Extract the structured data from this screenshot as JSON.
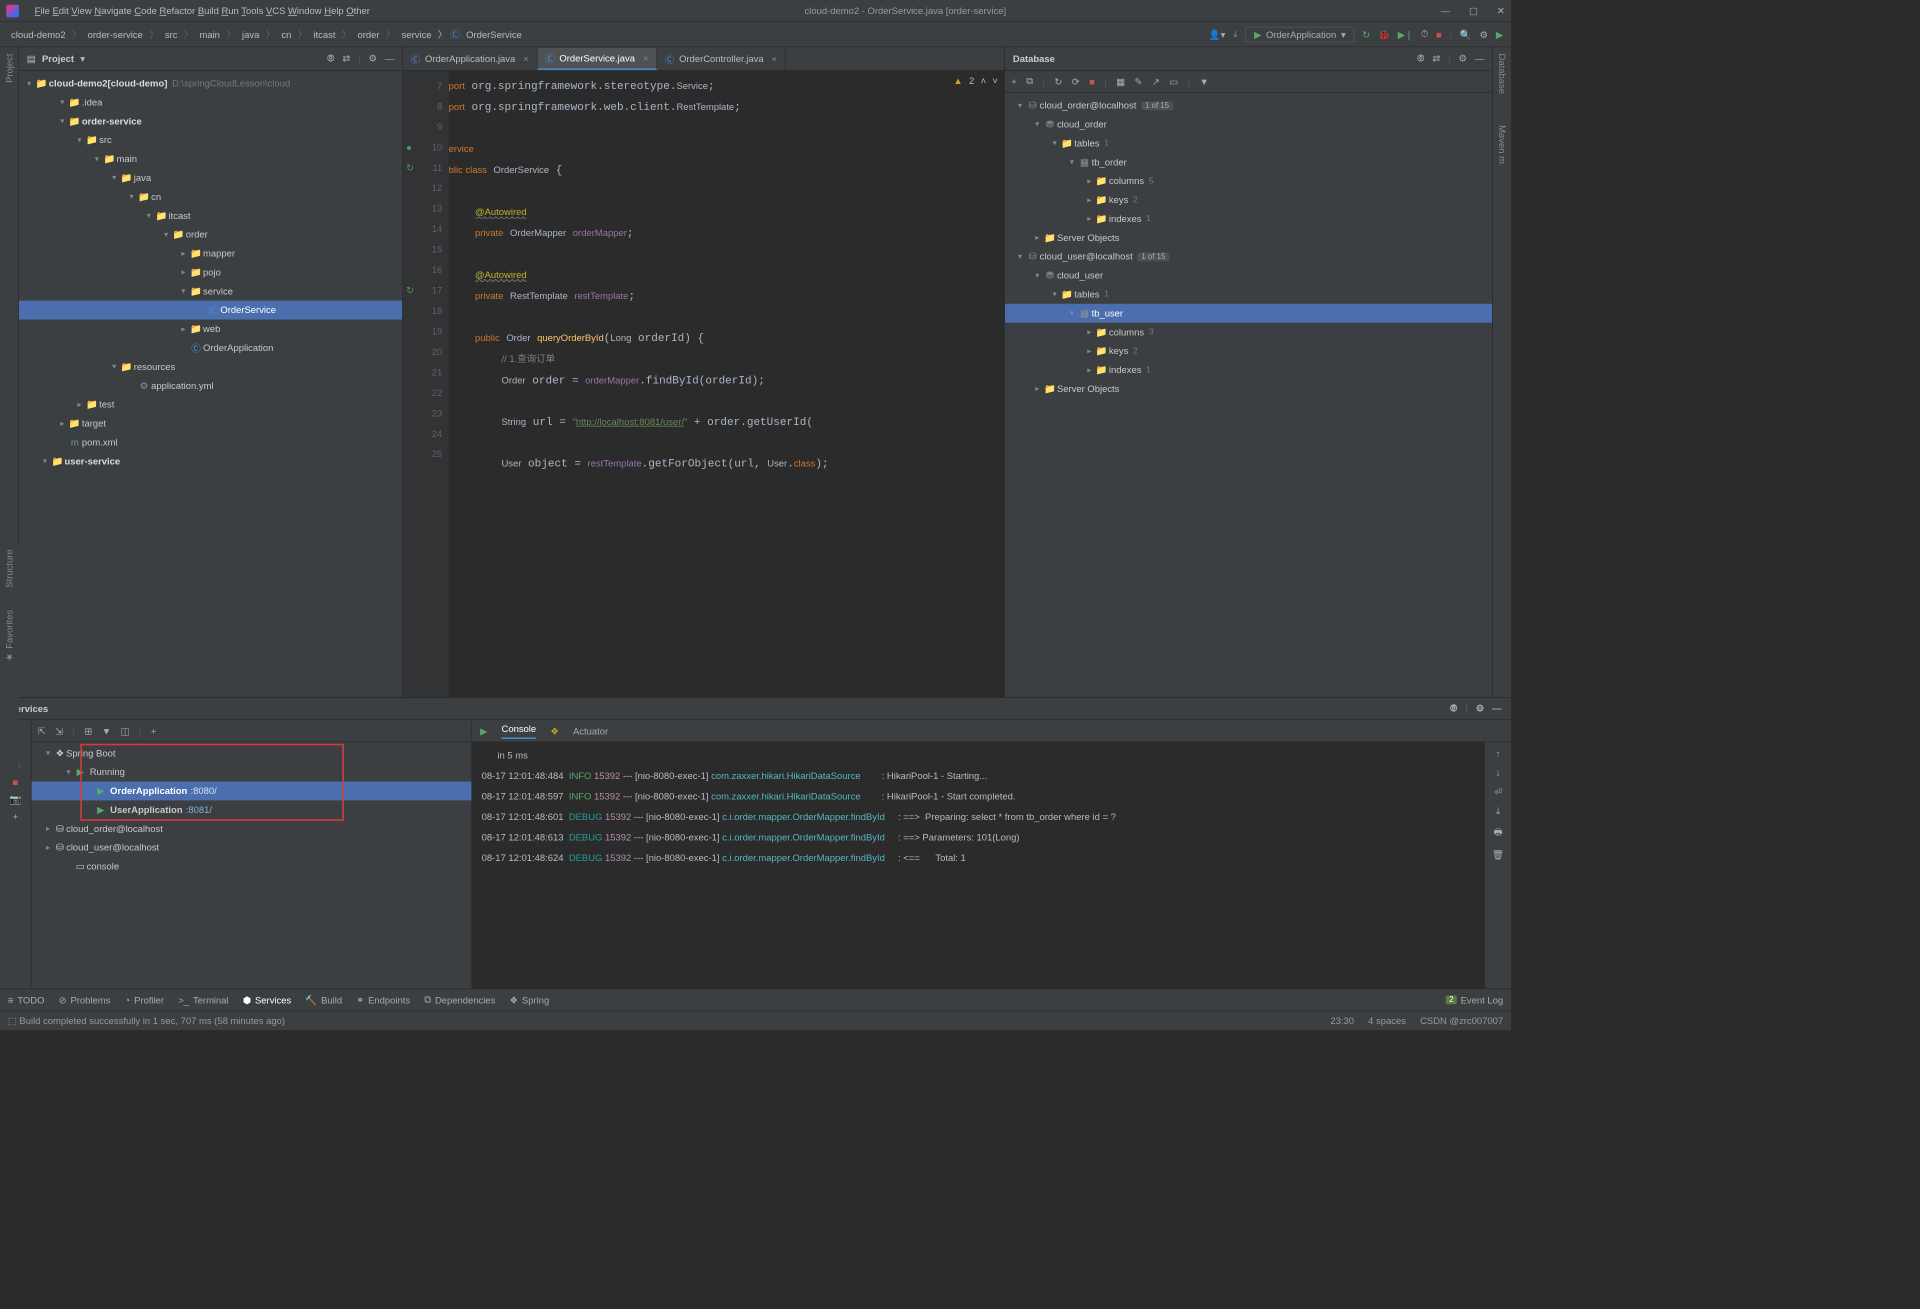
{
  "window_title": "cloud-demo2 - OrderService.java [order-service]",
  "menu": [
    "File",
    "Edit",
    "View",
    "Navigate",
    "Code",
    "Refactor",
    "Build",
    "Run",
    "Tools",
    "VCS",
    "Window",
    "Help",
    "Other"
  ],
  "breadcrumbs": [
    "cloud-demo2",
    "order-service",
    "src",
    "main",
    "java",
    "cn",
    "itcast",
    "order",
    "service",
    "OrderService"
  ],
  "run_config": "OrderApplication",
  "project": {
    "title": "Project",
    "root": {
      "name": "cloud-demo2",
      "bold": "[cloud-demo]",
      "path": "D:\\springCloudLesson\\cloud"
    },
    "nodes": [
      {
        "d": 1,
        "tw": "▾",
        "icon": "📁",
        "cls": "dir",
        "txt": ".idea"
      },
      {
        "d": 1,
        "tw": "▾",
        "icon": "📁",
        "cls": "pkg",
        "txt": "order-service",
        "bold": true
      },
      {
        "d": 2,
        "tw": "▾",
        "icon": "📁",
        "cls": "pkg",
        "txt": "src"
      },
      {
        "d": 3,
        "tw": "▾",
        "icon": "📁",
        "cls": "pkg",
        "txt": "main"
      },
      {
        "d": 4,
        "tw": "▾",
        "icon": "📁",
        "cls": "pkg",
        "txt": "java"
      },
      {
        "d": 5,
        "tw": "▾",
        "icon": "📁",
        "cls": "pkg",
        "txt": "cn"
      },
      {
        "d": 6,
        "tw": "▾",
        "icon": "📁",
        "cls": "pkg",
        "txt": "itcast"
      },
      {
        "d": 7,
        "tw": "▾",
        "icon": "📁",
        "cls": "pkg",
        "txt": "order"
      },
      {
        "d": 8,
        "tw": "▸",
        "icon": "📁",
        "cls": "pkg",
        "txt": "mapper"
      },
      {
        "d": 8,
        "tw": "▸",
        "icon": "📁",
        "cls": "pkg",
        "txt": "pojo"
      },
      {
        "d": 8,
        "tw": "▾",
        "icon": "📁",
        "cls": "pkg",
        "txt": "service"
      },
      {
        "d": 9,
        "tw": "",
        "icon": "Ⓒ",
        "cls": "file",
        "txt": "OrderService",
        "sel": true
      },
      {
        "d": 8,
        "tw": "▸",
        "icon": "📁",
        "cls": "pkg",
        "txt": "web"
      },
      {
        "d": 8,
        "tw": "",
        "icon": "Ⓒ",
        "cls": "file",
        "txt": "OrderApplication"
      },
      {
        "d": 4,
        "tw": "▾",
        "icon": "📁",
        "cls": "pkg",
        "txt": "resources"
      },
      {
        "d": 5,
        "tw": "",
        "icon": "⚙",
        "cls": "file",
        "txt": "application.yml"
      },
      {
        "d": 2,
        "tw": "▸",
        "icon": "📁",
        "cls": "dir",
        "txt": "test"
      },
      {
        "d": 1,
        "tw": "▸",
        "icon": "📁",
        "cls": "dir",
        "txt": "target",
        "orange": true
      },
      {
        "d": 1,
        "tw": "",
        "icon": "m",
        "cls": "file",
        "txt": "pom.xml"
      },
      {
        "d": 0,
        "tw": "▾",
        "icon": "📁",
        "cls": "pkg",
        "txt": "user-service",
        "bold": true
      }
    ]
  },
  "tabs": [
    {
      "name": "OrderApplication.java",
      "act": false
    },
    {
      "name": "OrderService.java",
      "act": true
    },
    {
      "name": "OrderController.java",
      "act": false
    }
  ],
  "editor": {
    "warn": "2",
    "lines": [
      7,
      8,
      9,
      10,
      11,
      12,
      13,
      14,
      15,
      16,
      17,
      18,
      19,
      20,
      21,
      22,
      23,
      24,
      25
    ],
    "gicons": {
      "10": "●",
      "11": "↻",
      "17": "↻"
    }
  },
  "database": {
    "title": "Database",
    "nodes": [
      {
        "d": 0,
        "tw": "▾",
        "icon": "⛁",
        "txt": "cloud_order@localhost",
        "pill": "1 of 15"
      },
      {
        "d": 1,
        "tw": "▾",
        "icon": "⛃",
        "txt": "cloud_order"
      },
      {
        "d": 2,
        "tw": "▾",
        "icon": "📁",
        "txt": "tables",
        "cnt": "1"
      },
      {
        "d": 3,
        "tw": "▾",
        "icon": "▦",
        "txt": "tb_order"
      },
      {
        "d": 4,
        "tw": "▸",
        "icon": "📁",
        "txt": "columns",
        "cnt": "5"
      },
      {
        "d": 4,
        "tw": "▸",
        "icon": "📁",
        "txt": "keys",
        "cnt": "2"
      },
      {
        "d": 4,
        "tw": "▸",
        "icon": "📁",
        "txt": "indexes",
        "cnt": "1"
      },
      {
        "d": 1,
        "tw": "▸",
        "icon": "📁",
        "txt": "Server Objects"
      },
      {
        "d": 0,
        "tw": "▾",
        "icon": "⛁",
        "txt": "cloud_user@localhost",
        "pill": "1 of 15"
      },
      {
        "d": 1,
        "tw": "▾",
        "icon": "⛃",
        "txt": "cloud_user"
      },
      {
        "d": 2,
        "tw": "▾",
        "icon": "📁",
        "txt": "tables",
        "cnt": "1"
      },
      {
        "d": 3,
        "tw": "▾",
        "icon": "▦",
        "txt": "tb_user",
        "sel": true
      },
      {
        "d": 4,
        "tw": "▸",
        "icon": "📁",
        "txt": "columns",
        "cnt": "3"
      },
      {
        "d": 4,
        "tw": "▸",
        "icon": "📁",
        "txt": "keys",
        "cnt": "2"
      },
      {
        "d": 4,
        "tw": "▸",
        "icon": "📁",
        "txt": "indexes",
        "cnt": "1"
      },
      {
        "d": 1,
        "tw": "▸",
        "icon": "📁",
        "txt": "Server Objects"
      }
    ]
  },
  "services": {
    "title": "Services",
    "tabs": [
      "Console",
      "Actuator"
    ],
    "tree": [
      {
        "d": 0,
        "tw": "▾",
        "icon": "❖",
        "txt": "Spring Boot"
      },
      {
        "d": 1,
        "tw": "▾",
        "icon": "▶",
        "txt": "Running",
        "gr": true
      },
      {
        "d": 2,
        "tw": "",
        "icon": "▶",
        "txt": "OrderApplication",
        "port": ":8080/",
        "sel": true,
        "gr": true,
        "app": true
      },
      {
        "d": 2,
        "tw": "",
        "icon": "▶",
        "txt": "UserApplication",
        "port": ":8081/",
        "gr": true,
        "app": true
      },
      {
        "d": 0,
        "tw": "▸",
        "icon": "⛁",
        "txt": "cloud_order@localhost"
      },
      {
        "d": 0,
        "tw": "▸",
        "icon": "⛁",
        "txt": "cloud_user@localhost"
      },
      {
        "d": 1,
        "tw": "",
        "icon": "▭",
        "txt": "console"
      }
    ],
    "console": [
      {
        "pre": "      in 5 ms"
      },
      {
        "ts": "08-17 12:01:48:484",
        "lv": "INFO",
        "pid": "15392",
        "th": "[nio-8080-exec-1]",
        "cl": "com.zaxxer.hikari.HikariDataSource",
        "msg": ": HikariPool-1 - Starting..."
      },
      {
        "ts": "08-17 12:01:48:597",
        "lv": "INFO",
        "pid": "15392",
        "th": "[nio-8080-exec-1]",
        "cl": "com.zaxxer.hikari.HikariDataSource",
        "msg": ": HikariPool-1 - Start completed."
      },
      {
        "ts": "08-17 12:01:48:601",
        "lv": "DEBUG",
        "pid": "15392",
        "th": "[nio-8080-exec-1]",
        "cl": "c.i.order.mapper.OrderMapper.findById",
        "msg": ": ==>  Preparing: select * from tb_order where id = ?"
      },
      {
        "ts": "08-17 12:01:48:613",
        "lv": "DEBUG",
        "pid": "15392",
        "th": "[nio-8080-exec-1]",
        "cl": "c.i.order.mapper.OrderMapper.findById",
        "msg": ": ==> Parameters: 101(Long)"
      },
      {
        "ts": "08-17 12:01:48:624",
        "lv": "DEBUG",
        "pid": "15392",
        "th": "[nio-8080-exec-1]",
        "cl": "c.i.order.mapper.OrderMapper.findById",
        "msg": ": <==      Total: 1"
      }
    ]
  },
  "bottom_tabs": [
    "TODO",
    "Problems",
    "Profiler",
    "Terminal",
    "Services",
    "Build",
    "Endpoints",
    "Dependencies",
    "Spring"
  ],
  "event_log": "Event Log",
  "status_msg": "Build completed successfully in 1 sec, 707 ms (58 minutes ago)",
  "status_right": [
    "23:30",
    "4 spaces",
    "CSDN @zrc007007"
  ]
}
